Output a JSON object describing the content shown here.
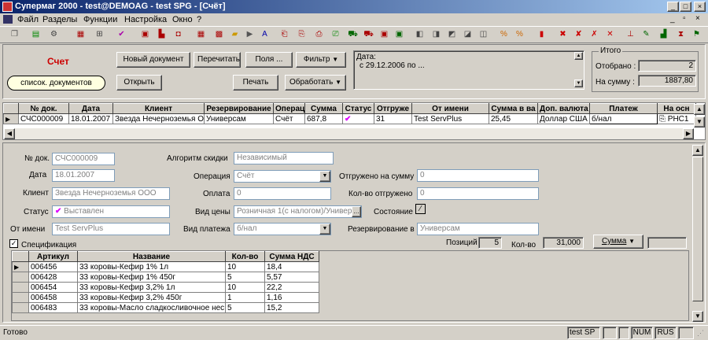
{
  "window": {
    "title": "Супермаг 2000 - test@DEMOAG - test SPG - [Счёт]"
  },
  "menu": [
    "Файл",
    "Разделы",
    "Функции",
    "Настройка",
    "Окно",
    "?"
  ],
  "top": {
    "doc_type": "Счет",
    "btn_new": "Новый документ",
    "btn_recalc": "Перечитать",
    "btn_fields": "Поля ...",
    "btn_filter": "Фильтр",
    "btn_doclist": "список. документов",
    "btn_open": "Открыть",
    "btn_print": "Печать",
    "btn_process": "Обработать",
    "filter_line1": "Дата:",
    "filter_line2": "с 29.12.2006 по ...",
    "totals_title": "Итого",
    "selected_label": "Отобрано :",
    "selected_value": "2",
    "sum_label": "На сумму :",
    "sum_value": "1887,80"
  },
  "doc_grid": {
    "headers": [
      "№ док.",
      "Дата",
      "Клиент",
      "Резервирование",
      "Операц",
      "Сумма",
      "Статус",
      "Отгруже",
      "От имени",
      "Сумма в ва",
      "Доп. валюта",
      "Платеж",
      "На осн"
    ],
    "row": [
      "СЧС000009",
      "18.01.2007",
      "Звезда Нечерноземья О",
      "Универсам",
      "Счёт",
      "687,8",
      "",
      "31",
      "Test ServPlus",
      "25,45",
      "Доллар США",
      "б/нал",
      "РНС1"
    ]
  },
  "form": {
    "docno_label": "№ док.",
    "docno": "СЧС000009",
    "date_label": "Дата",
    "date": "18.01.2007",
    "client_label": "Клиент",
    "client": "Звезда Нечерноземья ООО",
    "status_label": "Статус",
    "status": "Выставлен",
    "from_label": "От имени",
    "from": "Test ServPlus",
    "discount_label": "Алгоритм скидки",
    "discount": "Независимый",
    "operation_label": "Операция",
    "operation": "Счёт",
    "payment_label": "Оплата",
    "payment": "0",
    "pricetype_label": "Вид цены",
    "pricetype": "Розничная 1(с налогом)/Универ",
    "paytype_label": "Вид платежа",
    "paytype": "б/нал",
    "shipped_sum_label": "Отгружено на сумму",
    "shipped_sum": "0",
    "shipped_qty_label": "Кол-во отгружено",
    "shipped_qty": "0",
    "state_label": "Состояние",
    "reserve_label": "Резервирование в",
    "reserve": "Универсам",
    "spec_label": "Спецификация",
    "positions_label": "Позиций",
    "positions": "5",
    "qty_label": "Кол-во",
    "qty": "31,000",
    "sum_btn": "Сумма"
  },
  "spec": {
    "headers": [
      "Артикул",
      "Название",
      "Кол-во",
      "Сумма НДС"
    ],
    "rows": [
      [
        "006456",
        "33 коровы-Кефир 1% 1л",
        "10",
        "18,4"
      ],
      [
        "006428",
        "33 коровы-Кефир 1% 450г",
        "5",
        "5,57"
      ],
      [
        "006454",
        "33 коровы-Кефир 3,2% 1л",
        "10",
        "22,2"
      ],
      [
        "006458",
        "33 коровы-Кефир 3,2% 450г",
        "1",
        "1,16"
      ],
      [
        "006483",
        "33 коровы-Масло сладкосливочное нес",
        "5",
        "15,2"
      ]
    ]
  },
  "status": {
    "ready": "Готово",
    "user": "test SP",
    "num": "NUM",
    "lang": "RUS"
  }
}
